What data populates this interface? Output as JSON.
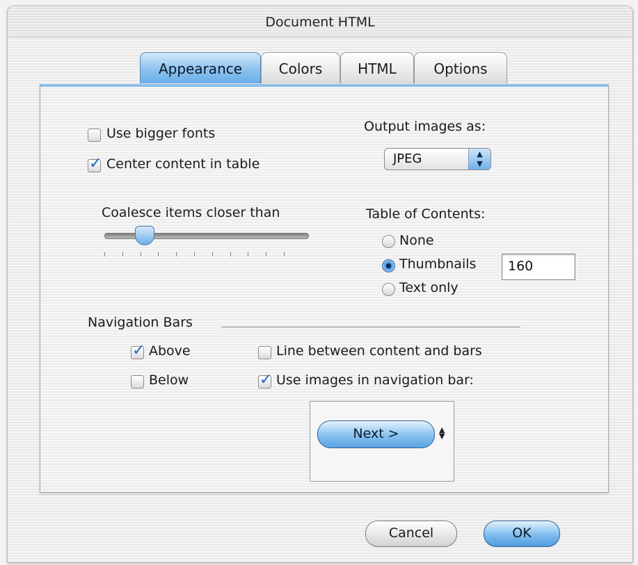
{
  "window": {
    "title": "Document HTML"
  },
  "tabs": [
    {
      "label": "Appearance",
      "selected": true
    },
    {
      "label": "Colors",
      "selected": false
    },
    {
      "label": "HTML",
      "selected": false
    },
    {
      "label": "Options",
      "selected": false
    }
  ],
  "appearance": {
    "bigger_fonts": {
      "label": "Use bigger fonts",
      "checked": false
    },
    "center_content": {
      "label": "Center content in table",
      "checked": true
    },
    "output_images": {
      "label": "Output images as:",
      "value": "JPEG"
    },
    "coalesce": {
      "label": "Coalesce items closer than",
      "tick_count": 11,
      "selected_tick_index": 2
    },
    "toc": {
      "label": "Table of Contents:",
      "options": [
        {
          "label": "None",
          "selected": false
        },
        {
          "label": "Thumbnails",
          "selected": true
        },
        {
          "label": "Text only",
          "selected": false
        }
      ],
      "thumbnail_size": "160"
    },
    "nav_bars": {
      "label": "Navigation Bars",
      "above": {
        "label": "Above",
        "checked": true
      },
      "below": {
        "label": "Below",
        "checked": false
      },
      "line_between": {
        "label": "Line between content and bars",
        "checked": false
      },
      "use_images": {
        "label": "Use images in navigation bar:",
        "checked": true
      },
      "preview_button": "Next >"
    }
  },
  "buttons": {
    "cancel": "Cancel",
    "ok": "OK"
  },
  "colors": {
    "accent": "#6aaee8",
    "checkmark": "#1e64b8"
  },
  "icons": {
    "check": "checkmark-icon",
    "popup": "updown-arrows-icon",
    "stepper": "stepper-arrows-icon"
  }
}
